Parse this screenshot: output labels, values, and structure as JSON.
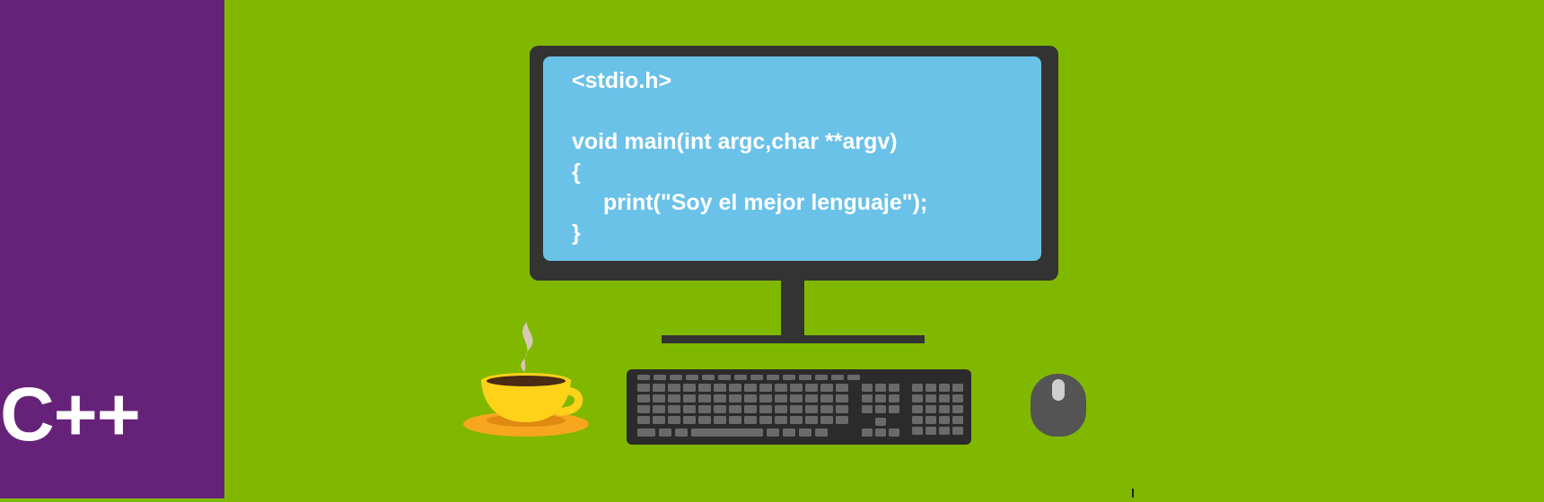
{
  "banner": {
    "language_label": "C++",
    "code_lines": [
      "<stdio.h>",
      "",
      "void main(int argc,char **argv)",
      "{",
      "print(\"Soy el mejor lenguaje\");",
      "}"
    ]
  },
  "colors": {
    "background": "#80b800",
    "side_panel": "#662279",
    "monitor": "#333333",
    "screen": "#6ac2e8",
    "cup": "#ffd21a",
    "saucer": "#f6a61f",
    "keyboard": "#2b2b2b",
    "mouse": "#545454"
  },
  "icons": {
    "cup": "coffee-cup-icon",
    "keyboard": "keyboard-icon",
    "mouse": "mouse-icon",
    "monitor": "monitor-icon"
  }
}
